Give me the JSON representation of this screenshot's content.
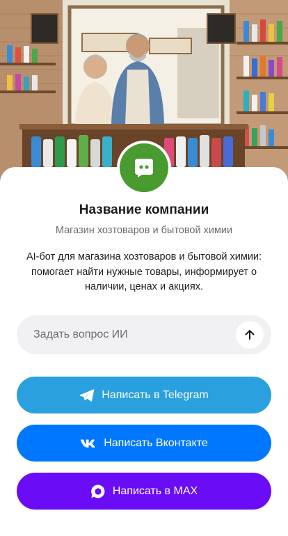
{
  "company": {
    "name": "Название компании",
    "subtitle": "Магазин хозтоваров и бытовой химии",
    "description": "AI-бот для магазина хозтоваров и бытовой химии: помогает найти нужные товары, информирует о наличии, ценах и акциях."
  },
  "ask": {
    "placeholder": "Задать вопрос ИИ",
    "send_icon": "arrow-up-icon"
  },
  "buttons": {
    "telegram": {
      "label": "Написать в Telegram",
      "icon": "telegram-icon",
      "color": "#2aa0de"
    },
    "vk": {
      "label": "Написать Вконтакте",
      "icon": "vk-icon",
      "color": "#0077ff"
    },
    "max": {
      "label": "Написать в MAX",
      "icon": "max-icon",
      "color": "#6a0cf5"
    }
  },
  "colors": {
    "avatar_bg": "#4a9b2f"
  }
}
